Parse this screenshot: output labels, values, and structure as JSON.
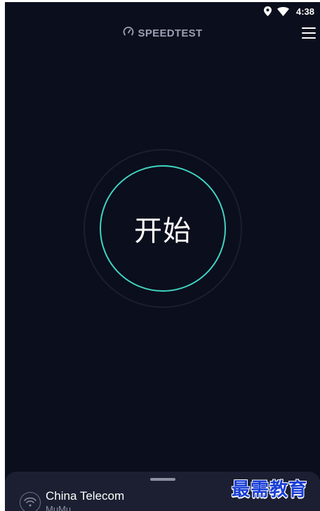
{
  "status_bar": {
    "time": "4:38",
    "icons": [
      "location-icon",
      "wifi-icon"
    ]
  },
  "app_bar": {
    "title": "SPEEDTEST",
    "logo_icon": "speedometer-icon",
    "menu_icon": "hamburger-menu-icon"
  },
  "main": {
    "go_button_label": "开始",
    "ring_color": "#3fd4c2"
  },
  "connection": {
    "provider": "China Telecom",
    "network": "MuMu",
    "icon": "wifi-icon"
  },
  "watermark": {
    "text": "最需教育",
    "color": "#1a3fd6"
  },
  "colors": {
    "background": "#0b0e1c",
    "sheet": "#1b1f31",
    "accent": "#3fd4c2"
  }
}
